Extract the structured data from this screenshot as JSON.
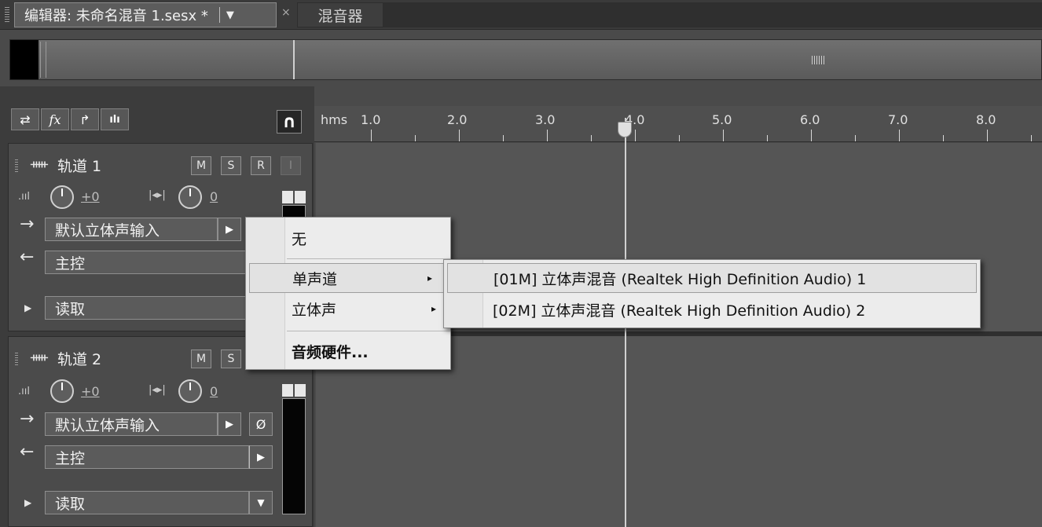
{
  "tabs": {
    "editor_label": "编辑器: 未命名混音 1.sesx *",
    "mixer_label": "混音器",
    "close_glyph": "×",
    "dropdown_glyph": "▼"
  },
  "tools": {
    "swap": "⇄",
    "fx": "fx",
    "send": "↱",
    "eq": "ılı",
    "snap": "∩"
  },
  "ruler": {
    "unit": "hms",
    "labels": [
      "1.0",
      "2.0",
      "3.0",
      "4.0",
      "5.0",
      "6.0",
      "7.0",
      "8.0"
    ]
  },
  "tracks": [
    {
      "name": "轨道 1",
      "buttons": [
        "M",
        "S",
        "R",
        "I"
      ],
      "volume": "+0",
      "pan": "0",
      "input": "默认立体声输入",
      "output": "主控",
      "mode": "读取"
    },
    {
      "name": "轨道 2",
      "buttons": [
        "M",
        "S"
      ],
      "volume": "+0",
      "pan": "0",
      "input": "默认立体声输入",
      "output": "主控",
      "mode": "读取",
      "phase": "Ø"
    }
  ],
  "menu": {
    "items": [
      {
        "label": "无"
      },
      {
        "label": "单声道",
        "submenu": true
      },
      {
        "label": "立体声",
        "submenu": true
      },
      {
        "label": "音频硬件..."
      }
    ],
    "submenu_arrow": "▸"
  },
  "submenu": {
    "items": [
      {
        "label": "[01M] 立体声混音 (Realtek High Definition Audio) 1"
      },
      {
        "label": "[02M] 立体声混音 (Realtek High Definition Audio) 2"
      }
    ]
  },
  "icons": {
    "input_arrow": "→",
    "output_arrow": "←",
    "expand": "▶",
    "dropdown": "▼",
    "right": "▶",
    "waveform": "ᚔ"
  }
}
